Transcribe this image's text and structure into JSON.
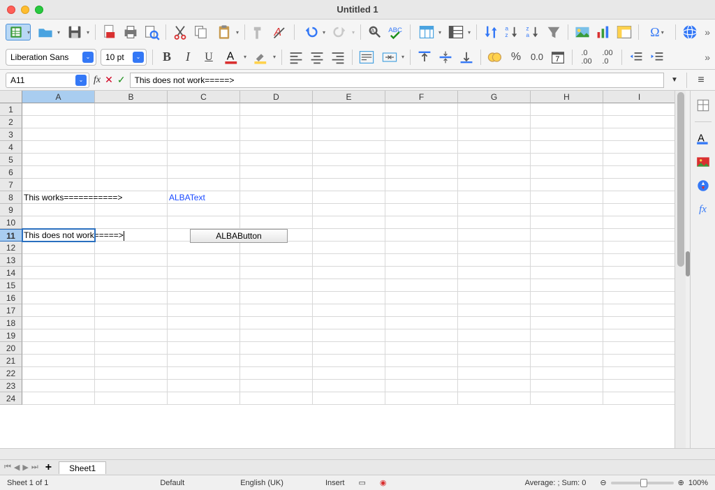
{
  "window": {
    "title": "Untitled 1"
  },
  "toolbar": {
    "font_name": "Liberation Sans",
    "font_size": "10 pt"
  },
  "formula": {
    "cell_ref": "A11",
    "input": "This does not work=====>"
  },
  "columns": [
    "A",
    "B",
    "C",
    "D",
    "E",
    "F",
    "G",
    "H",
    "I"
  ],
  "rows_visible": 24,
  "cells": {
    "A8": "This works===========>",
    "C8": "ALBAText",
    "A11": "This does not work=====>"
  },
  "form_control": {
    "label": "ALBAButton"
  },
  "tabs": {
    "sheet1": "Sheet1"
  },
  "status": {
    "sheet_info": "Sheet 1 of 1",
    "style": "Default",
    "lang": "English (UK)",
    "mode": "Insert",
    "aggregate": "Average: ; Sum: 0",
    "zoom": "100%"
  }
}
